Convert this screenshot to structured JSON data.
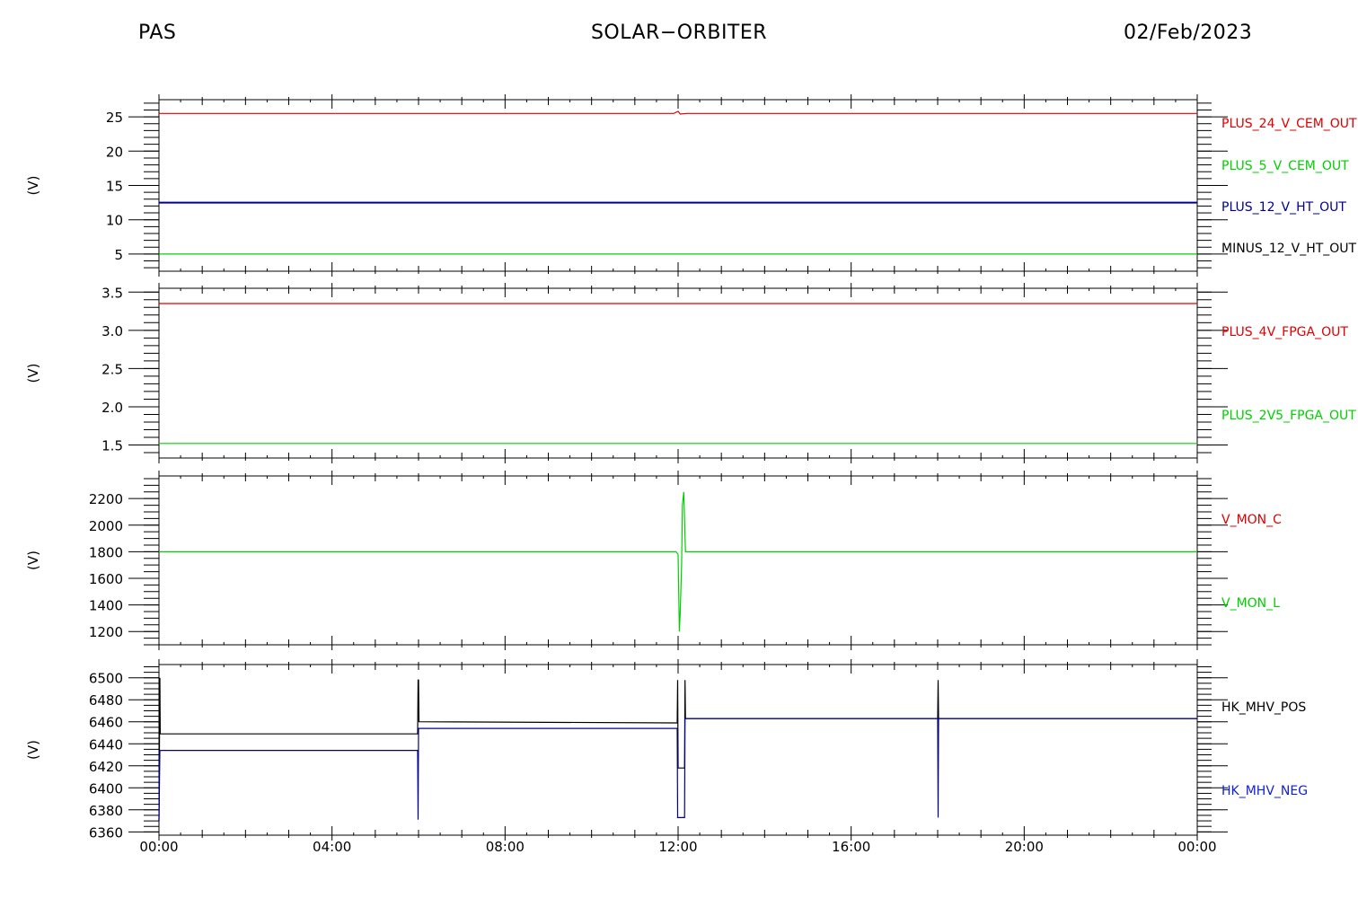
{
  "header": {
    "left": "PAS",
    "center": "SOLAR−ORBITER",
    "right": "02/Feb/2023"
  },
  "colors": {
    "red": "#e00000",
    "green": "#00d000",
    "blue": "#000090",
    "black": "#000000",
    "blue_bright": "#1020e0"
  },
  "x_axis": {
    "ticks": [
      "00:00",
      "04:00",
      "08:00",
      "12:00",
      "16:00",
      "20:00",
      "00:00"
    ],
    "range_hours": [
      0,
      24
    ]
  },
  "chart_data": [
    {
      "type": "line",
      "ylabel": "(V)",
      "ylim": [
        2.5,
        27.5
      ],
      "yticks": [
        5,
        10,
        15,
        20,
        25
      ],
      "yminor": 1,
      "series": [
        {
          "name": "PLUS_24_V_CEM_OUT",
          "color": "red",
          "x": [
            0,
            11.9,
            12.0,
            12.05,
            12.2,
            24
          ],
          "y": [
            25.5,
            25.5,
            25.8,
            25.4,
            25.5,
            25.5
          ]
        },
        {
          "name": "PLUS_5_V_CEM_OUT",
          "color": "green",
          "x": [
            0,
            24
          ],
          "y": [
            5.0,
            5.0
          ]
        },
        {
          "name": "PLUS_12_V_HT_OUT",
          "color": "blue",
          "x": [
            0,
            24
          ],
          "y": [
            12.5,
            12.5
          ]
        },
        {
          "name": "MINUS_12_V_HT_OUT",
          "color": "black",
          "x": [],
          "y": []
        }
      ]
    },
    {
      "type": "line",
      "ylabel": "(V)",
      "ylim": [
        1.33,
        3.55
      ],
      "yticks": [
        1.5,
        2.0,
        2.5,
        3.0,
        3.5
      ],
      "yminor": 0.1,
      "series": [
        {
          "name": "PLUS_4V_FPGA_OUT",
          "color": "red",
          "x": [
            0,
            24
          ],
          "y": [
            3.35,
            3.35
          ]
        },
        {
          "name": "PLUS_2V5_FPGA_OUT",
          "color": "green",
          "x": [
            0,
            24
          ],
          "y": [
            1.52,
            1.52
          ]
        }
      ]
    },
    {
      "type": "line",
      "ylabel": "(V)",
      "ylim": [
        1100,
        2370
      ],
      "yticks": [
        1200,
        1400,
        1600,
        1800,
        2000,
        2200
      ],
      "yminor": 50,
      "series": [
        {
          "name": "V_MON_C",
          "color": "red",
          "x": [],
          "y": []
        },
        {
          "name": "V_MON_L",
          "color": "green",
          "x": [
            0,
            11.95,
            12.0,
            12.03,
            12.05,
            12.08,
            12.1,
            12.13,
            12.17,
            24
          ],
          "y": [
            1800,
            1800,
            1780,
            1200,
            1350,
            1700,
            2150,
            2250,
            1800,
            1800
          ]
        }
      ]
    },
    {
      "type": "line",
      "ylabel": "(V)",
      "ylim": [
        6357,
        6512
      ],
      "yticks": [
        6360,
        6380,
        6400,
        6420,
        6440,
        6460,
        6480,
        6500
      ],
      "yminor": 5,
      "series": [
        {
          "name": "HK_MHV_POS",
          "color": "black",
          "x": [
            0,
            0.02,
            0.03,
            0.05,
            0.06,
            5.98,
            5.99,
            6.0,
            6.01,
            6.02,
            11.98,
            11.99,
            12.0,
            12.01,
            12.02,
            12.15,
            12.16,
            12.17,
            12.18,
            12.2,
            18.0,
            18.01,
            18.02,
            18.03,
            24
          ],
          "y": [
            6370,
            6500,
            6449,
            6449,
            6449,
            6449,
            6498,
            6498,
            6460,
            6460,
            6459,
            6498,
            6418,
            6418,
            6418,
            6418,
            6498,
            6463,
            6463,
            6463,
            6463,
            6498,
            6463,
            6463,
            6463
          ]
        },
        {
          "name": "HK_MHV_NEG",
          "color": "blue",
          "x": [
            0,
            0.02,
            0.03,
            0.05,
            5.98,
            5.99,
            6.0,
            6.01,
            6.02,
            11.98,
            11.99,
            12.0,
            12.01,
            12.15,
            12.16,
            12.17,
            12.18,
            18.0,
            18.01,
            18.02,
            18.03,
            24
          ],
          "y": [
            6370,
            6434,
            6434,
            6434,
            6434,
            6371,
            6454,
            6454,
            6454,
            6454,
            6373,
            6373,
            6373,
            6373,
            6463,
            6463,
            6463,
            6463,
            6373,
            6463,
            6463,
            6463
          ]
        }
      ]
    }
  ]
}
